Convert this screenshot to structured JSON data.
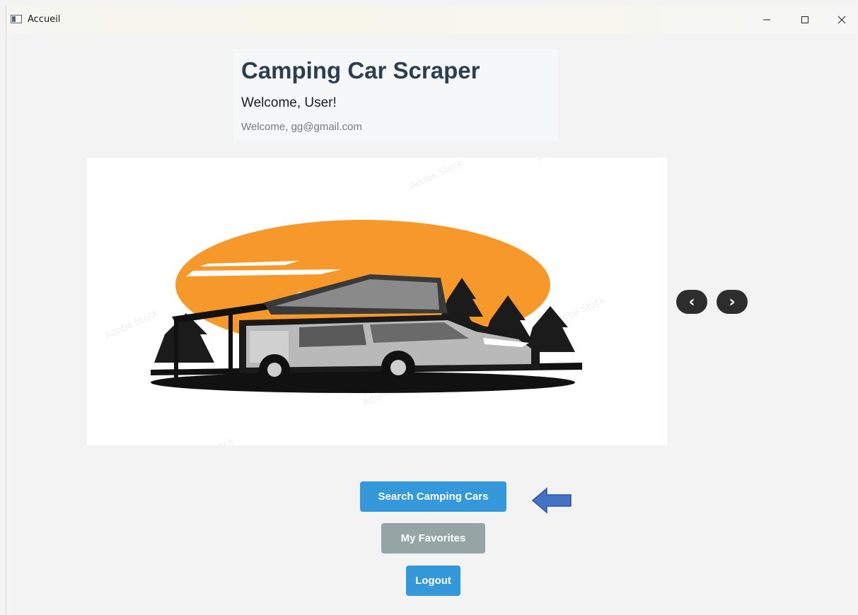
{
  "window": {
    "title": "Accueil",
    "controls": {
      "minimize": "—",
      "maximize": "☐",
      "close": "✕"
    }
  },
  "header": {
    "title": "Camping Car Scraper",
    "welcome_user": "Welcome, User!",
    "welcome_email": "Welcome, gg@gmail.com"
  },
  "carousel": {
    "image_subject": "camper-van-illustration",
    "prev_label": "‹",
    "next_label": "›"
  },
  "actions": {
    "search_label": "Search Camping Cars",
    "favorites_label": "My Favorites",
    "logout_label": "Logout"
  },
  "colors": {
    "title_text": "#2c3e50",
    "primary_button": "#3498db",
    "secondary_button": "#95a5a6",
    "nav_button": "#2d2d2d",
    "arrow_indicator": "#4472c4",
    "sun_orange": "#f7982a"
  }
}
